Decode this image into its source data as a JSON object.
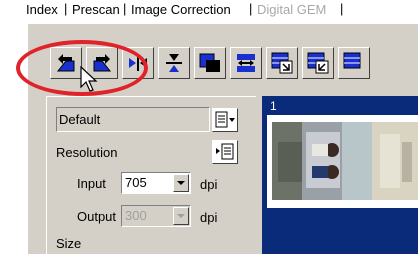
{
  "tabs": [
    {
      "label": "Index",
      "enabled": true
    },
    {
      "label": "Prescan",
      "enabled": true
    },
    {
      "label": "Image Correction",
      "enabled": true
    },
    {
      "label": "Digital GEM",
      "enabled": false
    }
  ],
  "toolbar": {
    "buttons": [
      {
        "name": "rotate-left-icon"
      },
      {
        "name": "rotate-right-icon"
      },
      {
        "name": "flip-horizontal-icon"
      },
      {
        "name": "flip-vertical-icon"
      },
      {
        "name": "invert-icon"
      },
      {
        "name": "move-icon"
      },
      {
        "name": "crop-image-icon"
      },
      {
        "name": "crop-image-alt-icon"
      }
    ]
  },
  "settings": {
    "preset_value": "Default",
    "resolution_label": "Resolution",
    "input_label": "Input",
    "input_value": "705",
    "input_unit": "dpi",
    "output_label": "Output",
    "output_value": "300",
    "output_unit": "dpi",
    "size_label": "Size"
  },
  "thumbnails": [
    {
      "number": "1"
    }
  ],
  "colors": {
    "panel": "#d4d0c8",
    "thumbnail_bg": "#0a2a7a",
    "highlight": "#e0232b",
    "icon_blue": "#1a2fd0"
  }
}
